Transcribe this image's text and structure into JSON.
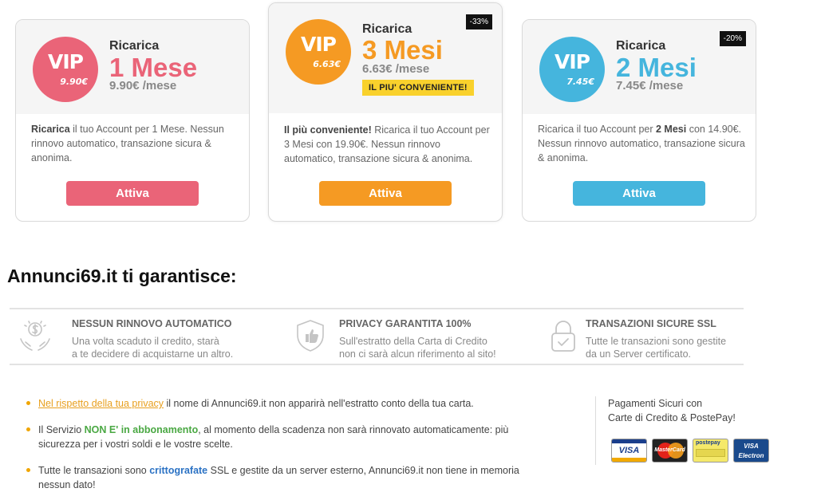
{
  "plans": [
    {
      "label": "Ricarica",
      "period": "1 Mese",
      "per_month": "9.90€ /mese",
      "badge_vip": "VIP",
      "badge_price": "9.90€",
      "discount": "",
      "highlight": "",
      "description_bold": "Ricarica",
      "description_rest": " il tuo Account per 1 Mese. Nessun rinnovo automatico, transazione sicura & anonima.",
      "button": "Attiva",
      "color": "#ea6478"
    },
    {
      "label": "Ricarica",
      "period": "3 Mesi",
      "per_month": "6.63€ /mese",
      "badge_vip": "VIP",
      "badge_price": "6.63€",
      "discount": "-33%",
      "highlight": "IL PIU' CONVENIENTE!",
      "description_bold": "Il più conveniente!",
      "description_rest": " Ricarica il tuo Account per 3 Mesi con 19.90€. Nessun rinnovo automatico, transazione sicura & anonima.",
      "button": "Attiva",
      "color": "#f59a23"
    },
    {
      "label": "Ricarica",
      "period": "2 Mesi",
      "per_month": "7.45€ /mese",
      "badge_vip": "VIP",
      "badge_price": "7.45€",
      "discount": "-20%",
      "highlight": "",
      "description_pre": "Ricarica il tuo Account per ",
      "description_bold": "2 Mesi",
      "description_rest": " con 14.90€. Nessun rinnovo automatico, transazione sicura & anonima.",
      "button": "Attiva",
      "color": "#45b5dd"
    }
  ],
  "guarantee": {
    "title": "Annunci69.it ti garantisce:",
    "items": [
      {
        "icon": "money-hands-icon",
        "heading": "NESSUN RINNOVO AUTOMATICO",
        "line1": "Una volta scaduto il credito, starà",
        "line2": "a te decidere di acquistarne un altro."
      },
      {
        "icon": "shield-thumb-icon",
        "heading": "PRIVACY GARANTITA 100%",
        "line1": "Sull'estratto della Carta di Credito",
        "line2": "non ci sarà alcun riferimento al sito!"
      },
      {
        "icon": "padlock-icon",
        "heading": "TRANSAZIONI SICURE SSL",
        "line1": "Tutte le transazioni sono gestite",
        "line2": "da un Server certificato."
      }
    ]
  },
  "bullets": {
    "b1_link": "Nel rispetto della tua privacy",
    "b1_rest": " il nome di Annunci69.it non apparirà nell'estratto conto della tua carta.",
    "b2_pre": "Il Servizio ",
    "b2_green": "NON E' in abbonamento",
    "b2_rest": ", al momento della scadenza non sarà rinnovato automaticamente: più sicurezza per i vostri soldi e le vostre scelte.",
    "b3_pre": "Tutte le transazioni sono ",
    "b3_blue": "crittografate",
    "b3_rest": " SSL e gestite da un server esterno, Annunci69.it non tiene in memoria nessun dato!"
  },
  "payments": {
    "line1": "Pagamenti Sicuri con",
    "line2": "Carte di Credito & PostePay!",
    "cards": [
      "VISA",
      "MasterCard",
      "postepay",
      "VISA Electron"
    ]
  }
}
